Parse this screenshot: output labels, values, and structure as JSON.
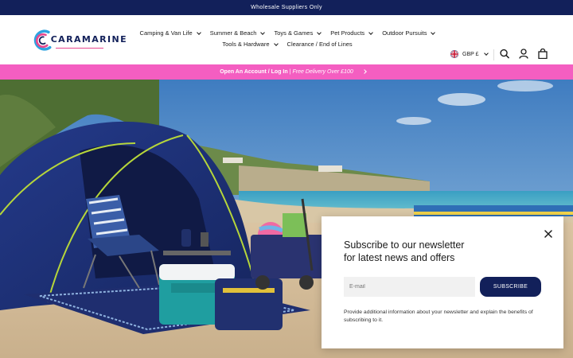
{
  "topbar": {
    "text": "Wholesale Suppliers Only"
  },
  "brand": {
    "name": "CARAMARINE",
    "colors": {
      "navy": "#12205a",
      "pink": "#f45ec1",
      "magenta": "#e8488f",
      "blue": "#2ea3e0"
    }
  },
  "nav": {
    "items": [
      {
        "label": "Camping & Van Life"
      },
      {
        "label": "Summer & Beach"
      },
      {
        "label": "Toys & Games"
      },
      {
        "label": "Pet Products"
      },
      {
        "label": "Outdoor Pursuits"
      },
      {
        "label": "Tools & Hardware"
      },
      {
        "label": "Clearance / End of Lines"
      }
    ]
  },
  "locale": {
    "label": "GBP £",
    "flag_icon": "uk-flag-icon"
  },
  "header_icons": [
    "search-icon",
    "account-icon",
    "bag-icon"
  ],
  "promo": {
    "link_text": "Open An Account / Log In",
    "separator": "|",
    "offer": "Free Delivery Over £100",
    "icon": "chevron-right-icon"
  },
  "hero": {
    "image": "beach-camping-scene"
  },
  "newsletter": {
    "title_line1": "Subscribe to our newsletter",
    "title_line2": "for latest news and offers",
    "email_placeholder": "E-mail",
    "button_label": "SUBSCRIBE",
    "info": "Provide additional information about your newsletter and explain the benefits of subscribing to it.",
    "close_icon": "close-icon"
  }
}
